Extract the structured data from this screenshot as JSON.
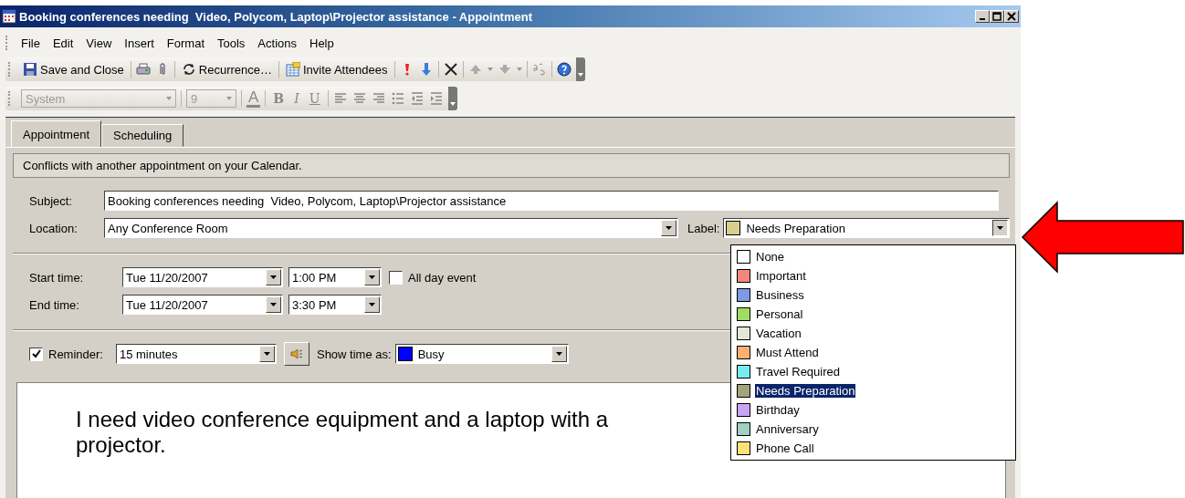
{
  "window": {
    "title": "Booking conferences needing  Video, Polycom, Laptop\\Projector assistance - Appointment"
  },
  "menu": [
    "File",
    "Edit",
    "View",
    "Insert",
    "Format",
    "Tools",
    "Actions",
    "Help"
  ],
  "toolbar": {
    "save": "Save and Close",
    "recurrence": "Recurrence…",
    "invite": "Invite Attendees"
  },
  "format_toolbar": {
    "font": "System",
    "size": "9",
    "color_glyph": "A",
    "bold": "B",
    "italic": "I",
    "underline": "U"
  },
  "tabs": [
    {
      "label": "Appointment",
      "selected": true
    },
    {
      "label": "Scheduling",
      "selected": false
    }
  ],
  "info_bar": "Conflicts with another appointment on your Calendar.",
  "subject": {
    "label": "Subject:",
    "value": "Booking conferences needing  Video, Polycom, Laptop\\Projector assistance"
  },
  "location": {
    "label": "Location:",
    "value": "Any Conference Room"
  },
  "label_field": {
    "label": "Label:",
    "value": "Needs Preparation",
    "expanded": true
  },
  "label_options": [
    {
      "name": "None",
      "color": "#ffffff",
      "selected": false
    },
    {
      "name": "Important",
      "color": "#f4877c",
      "selected": false
    },
    {
      "name": "Business",
      "color": "#7e9ae3",
      "selected": false
    },
    {
      "name": "Personal",
      "color": "#a0dc64",
      "selected": false
    },
    {
      "name": "Vacation",
      "color": "#e6e6d6",
      "selected": false
    },
    {
      "name": "Must Attend",
      "color": "#fdb072",
      "selected": false
    },
    {
      "name": "Travel Required",
      "color": "#76ecf0",
      "selected": false
    },
    {
      "name": "Needs Preparation",
      "color": "#a3a37c",
      "selected": true
    },
    {
      "name": "Birthday",
      "color": "#c8a4f4",
      "selected": false
    },
    {
      "name": "Anniversary",
      "color": "#a0cfc4",
      "selected": false
    },
    {
      "name": "Phone Call",
      "color": "#fee276",
      "selected": false
    }
  ],
  "start": {
    "label": "Start time:",
    "date": "Tue 11/20/2007",
    "time": "1:00 PM"
  },
  "end": {
    "label": "End time:",
    "date": "Tue 11/20/2007",
    "time": "3:30 PM"
  },
  "all_day": {
    "label": "All day event",
    "checked": false
  },
  "reminder": {
    "label": "Reminder:",
    "checked": true,
    "value": "15 minutes"
  },
  "show_time": {
    "label": "Show time as:",
    "value": "Busy"
  },
  "body": "I need video conference equipment and a laptop with a projector."
}
